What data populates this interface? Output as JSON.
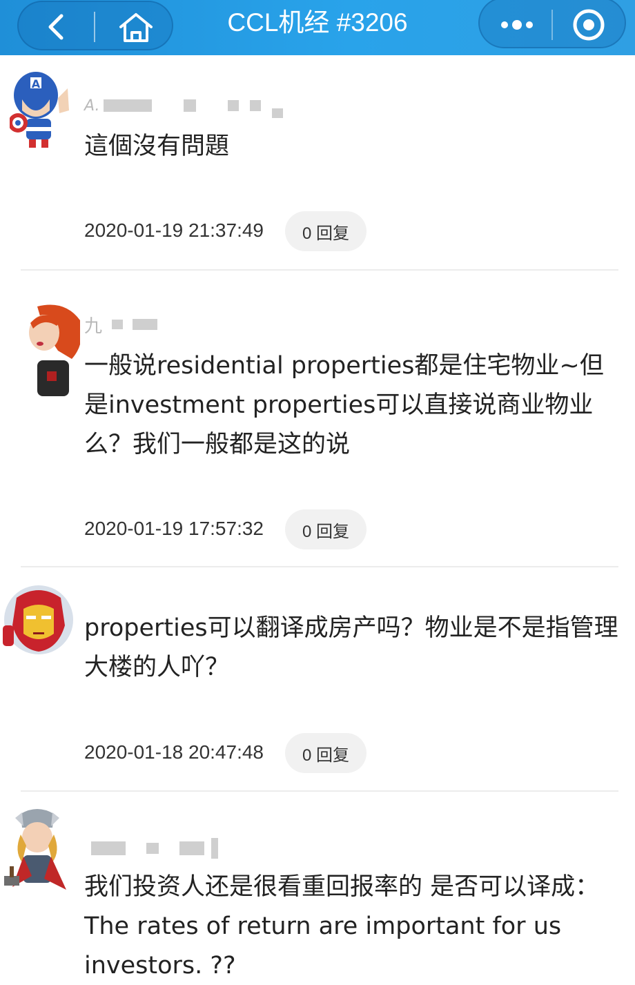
{
  "header": {
    "title": "CCL机经 #3206",
    "accent": "#29a3ea",
    "back_icon": "chevron-left-icon",
    "home_icon": "home-icon",
    "more_icon": "more-dots-icon",
    "close_icon": "target-close-icon"
  },
  "comments": [
    {
      "avatar": "captain-america-avatar",
      "username_visible": "A.",
      "body": "這個沒有問題",
      "timestamp": "2020-01-19 21:37:49",
      "reply_label": "0 回复"
    },
    {
      "avatar": "black-widow-avatar",
      "username_visible": "九",
      "body": "一般说residential properties都是住宅物业~但是investment properties可以直接说商业物业么？我们一般都是这的说",
      "timestamp": "2020-01-19 17:57:32",
      "reply_label": "0 回复"
    },
    {
      "avatar": "iron-man-avatar",
      "username_visible": "",
      "body": "properties可以翻译成房产吗？物业是不是指管理大楼的人吖？",
      "timestamp": "2020-01-18 20:47:48",
      "reply_label": "0 回复"
    },
    {
      "avatar": "thor-avatar",
      "username_visible": "",
      "body": "我们投资人还是很看重回报率的 是否可以译成：The rates of return are important for us investors. ??",
      "timestamp": "",
      "reply_label": ""
    }
  ]
}
